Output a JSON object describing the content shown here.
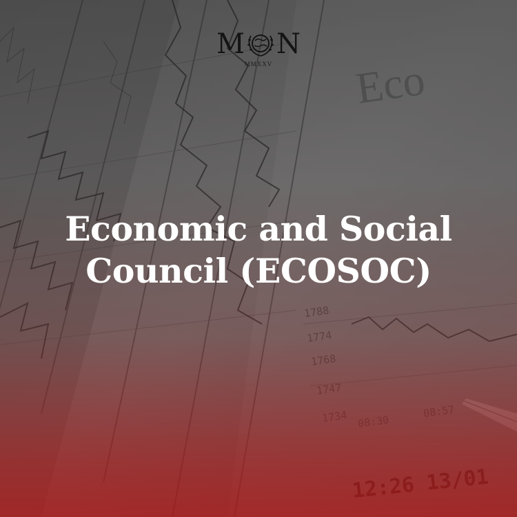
{
  "logo": {
    "left_letter": "M",
    "right_letter": "N",
    "subtitle": "MMXXV"
  },
  "title": {
    "line1": "Economic and Social",
    "line2": "Council (ECOSOC)"
  },
  "background": {
    "description_hint": "",
    "text": {
      "big_word": "Eco",
      "tick_1788": "1788",
      "tick_1774": "1774",
      "tick_1768": "1768",
      "tick_1747": "1747",
      "tick_1734": "1734",
      "time_0830": "08:30",
      "time_0857": "08:57",
      "stamp": "12:26 13/01"
    }
  },
  "colors": {
    "accent_red": "#a51616",
    "dark": "#222222",
    "title_text": "#ffffff"
  }
}
